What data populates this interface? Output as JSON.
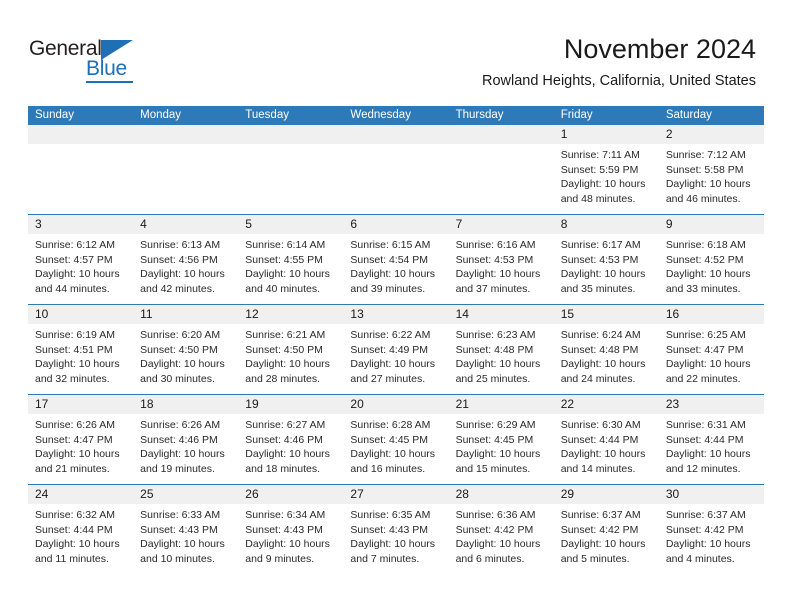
{
  "brand": {
    "name_part1": "General",
    "name_part2": "Blue",
    "accent_color": "#1f6fb5"
  },
  "header": {
    "title": "November 2024",
    "subtitle": "Rowland Heights, California, United States"
  },
  "calendar": {
    "header_color": "#2e7ab8",
    "daynum_band_color": "#f0f0f0",
    "weekdays": [
      "Sunday",
      "Monday",
      "Tuesday",
      "Wednesday",
      "Thursday",
      "Friday",
      "Saturday"
    ],
    "weeks": [
      [
        {
          "day": "",
          "lines": []
        },
        {
          "day": "",
          "lines": []
        },
        {
          "day": "",
          "lines": []
        },
        {
          "day": "",
          "lines": []
        },
        {
          "day": "",
          "lines": []
        },
        {
          "day": "1",
          "lines": [
            "Sunrise: 7:11 AM",
            "Sunset: 5:59 PM",
            "Daylight: 10 hours",
            "and 48 minutes."
          ]
        },
        {
          "day": "2",
          "lines": [
            "Sunrise: 7:12 AM",
            "Sunset: 5:58 PM",
            "Daylight: 10 hours",
            "and 46 minutes."
          ]
        }
      ],
      [
        {
          "day": "3",
          "lines": [
            "Sunrise: 6:12 AM",
            "Sunset: 4:57 PM",
            "Daylight: 10 hours",
            "and 44 minutes."
          ]
        },
        {
          "day": "4",
          "lines": [
            "Sunrise: 6:13 AM",
            "Sunset: 4:56 PM",
            "Daylight: 10 hours",
            "and 42 minutes."
          ]
        },
        {
          "day": "5",
          "lines": [
            "Sunrise: 6:14 AM",
            "Sunset: 4:55 PM",
            "Daylight: 10 hours",
            "and 40 minutes."
          ]
        },
        {
          "day": "6",
          "lines": [
            "Sunrise: 6:15 AM",
            "Sunset: 4:54 PM",
            "Daylight: 10 hours",
            "and 39 minutes."
          ]
        },
        {
          "day": "7",
          "lines": [
            "Sunrise: 6:16 AM",
            "Sunset: 4:53 PM",
            "Daylight: 10 hours",
            "and 37 minutes."
          ]
        },
        {
          "day": "8",
          "lines": [
            "Sunrise: 6:17 AM",
            "Sunset: 4:53 PM",
            "Daylight: 10 hours",
            "and 35 minutes."
          ]
        },
        {
          "day": "9",
          "lines": [
            "Sunrise: 6:18 AM",
            "Sunset: 4:52 PM",
            "Daylight: 10 hours",
            "and 33 minutes."
          ]
        }
      ],
      [
        {
          "day": "10",
          "lines": [
            "Sunrise: 6:19 AM",
            "Sunset: 4:51 PM",
            "Daylight: 10 hours",
            "and 32 minutes."
          ]
        },
        {
          "day": "11",
          "lines": [
            "Sunrise: 6:20 AM",
            "Sunset: 4:50 PM",
            "Daylight: 10 hours",
            "and 30 minutes."
          ]
        },
        {
          "day": "12",
          "lines": [
            "Sunrise: 6:21 AM",
            "Sunset: 4:50 PM",
            "Daylight: 10 hours",
            "and 28 minutes."
          ]
        },
        {
          "day": "13",
          "lines": [
            "Sunrise: 6:22 AM",
            "Sunset: 4:49 PM",
            "Daylight: 10 hours",
            "and 27 minutes."
          ]
        },
        {
          "day": "14",
          "lines": [
            "Sunrise: 6:23 AM",
            "Sunset: 4:48 PM",
            "Daylight: 10 hours",
            "and 25 minutes."
          ]
        },
        {
          "day": "15",
          "lines": [
            "Sunrise: 6:24 AM",
            "Sunset: 4:48 PM",
            "Daylight: 10 hours",
            "and 24 minutes."
          ]
        },
        {
          "day": "16",
          "lines": [
            "Sunrise: 6:25 AM",
            "Sunset: 4:47 PM",
            "Daylight: 10 hours",
            "and 22 minutes."
          ]
        }
      ],
      [
        {
          "day": "17",
          "lines": [
            "Sunrise: 6:26 AM",
            "Sunset: 4:47 PM",
            "Daylight: 10 hours",
            "and 21 minutes."
          ]
        },
        {
          "day": "18",
          "lines": [
            "Sunrise: 6:26 AM",
            "Sunset: 4:46 PM",
            "Daylight: 10 hours",
            "and 19 minutes."
          ]
        },
        {
          "day": "19",
          "lines": [
            "Sunrise: 6:27 AM",
            "Sunset: 4:46 PM",
            "Daylight: 10 hours",
            "and 18 minutes."
          ]
        },
        {
          "day": "20",
          "lines": [
            "Sunrise: 6:28 AM",
            "Sunset: 4:45 PM",
            "Daylight: 10 hours",
            "and 16 minutes."
          ]
        },
        {
          "day": "21",
          "lines": [
            "Sunrise: 6:29 AM",
            "Sunset: 4:45 PM",
            "Daylight: 10 hours",
            "and 15 minutes."
          ]
        },
        {
          "day": "22",
          "lines": [
            "Sunrise: 6:30 AM",
            "Sunset: 4:44 PM",
            "Daylight: 10 hours",
            "and 14 minutes."
          ]
        },
        {
          "day": "23",
          "lines": [
            "Sunrise: 6:31 AM",
            "Sunset: 4:44 PM",
            "Daylight: 10 hours",
            "and 12 minutes."
          ]
        }
      ],
      [
        {
          "day": "24",
          "lines": [
            "Sunrise: 6:32 AM",
            "Sunset: 4:44 PM",
            "Daylight: 10 hours",
            "and 11 minutes."
          ]
        },
        {
          "day": "25",
          "lines": [
            "Sunrise: 6:33 AM",
            "Sunset: 4:43 PM",
            "Daylight: 10 hours",
            "and 10 minutes."
          ]
        },
        {
          "day": "26",
          "lines": [
            "Sunrise: 6:34 AM",
            "Sunset: 4:43 PM",
            "Daylight: 10 hours",
            "and 9 minutes."
          ]
        },
        {
          "day": "27",
          "lines": [
            "Sunrise: 6:35 AM",
            "Sunset: 4:43 PM",
            "Daylight: 10 hours",
            "and 7 minutes."
          ]
        },
        {
          "day": "28",
          "lines": [
            "Sunrise: 6:36 AM",
            "Sunset: 4:42 PM",
            "Daylight: 10 hours",
            "and 6 minutes."
          ]
        },
        {
          "day": "29",
          "lines": [
            "Sunrise: 6:37 AM",
            "Sunset: 4:42 PM",
            "Daylight: 10 hours",
            "and 5 minutes."
          ]
        },
        {
          "day": "30",
          "lines": [
            "Sunrise: 6:37 AM",
            "Sunset: 4:42 PM",
            "Daylight: 10 hours",
            "and 4 minutes."
          ]
        }
      ]
    ]
  }
}
